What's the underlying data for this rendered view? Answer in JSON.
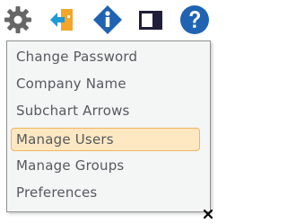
{
  "toolbar": {
    "icons": [
      "gear-icon",
      "exit-arrow-icon",
      "info-icon",
      "panel-icon",
      "help-icon"
    ]
  },
  "menu": {
    "items": [
      {
        "label": "Change Password"
      },
      {
        "label": "Company Name"
      },
      {
        "label": "Subchart Arrows"
      },
      {
        "label": "Manage Users",
        "selected": true
      },
      {
        "label": "Manage Groups"
      },
      {
        "label": "Preferences"
      }
    ]
  },
  "colors": {
    "icon_gray": "#666666",
    "accent_orange": "#f4a52a",
    "info_blue": "#1f63b2",
    "help_blue": "#1f63b2",
    "selected_bg": "#fde8c2",
    "selected_border": "#f3b45c",
    "menu_text": "#555a5e"
  }
}
